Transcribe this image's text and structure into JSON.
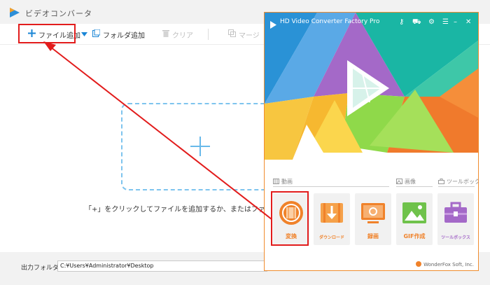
{
  "converter_window": {
    "title": "ビデオコンバータ",
    "toolbar": {
      "add_file": "ファイル追加",
      "add_folder": "フォルダ追加",
      "clear": "クリア",
      "merge": "マージ"
    },
    "drop_hint": "「+」をクリックしてファイルを追加するか、またはファイルをここま",
    "output_label": "出力フォルダ：",
    "output_path": "C:¥Users¥Administrator¥Desktop"
  },
  "hd_window": {
    "title": "HD Video Converter Factory Pro",
    "categories": {
      "video": "動画",
      "image": "画像",
      "toolbox": "ツールボックス"
    },
    "tiles": [
      {
        "label": "変換"
      },
      {
        "label": "ダウンロード"
      },
      {
        "label": "録画"
      },
      {
        "label": "GIF作成"
      },
      {
        "label": "ツールボックス"
      }
    ],
    "footer": "WonderFox Soft, Inc."
  },
  "colors": {
    "accent_orange": "#f0822a",
    "highlight_red": "#e21c1c",
    "drop_blue": "#7ec4ee"
  }
}
